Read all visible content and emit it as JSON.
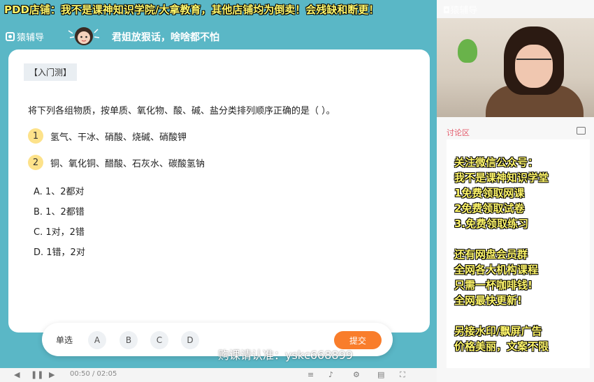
{
  "banner": "PDD店铺：我不是课神知识学院/大拿教育，其他店铺均为倒卖！会残缺和断更！",
  "watermark_top": "◘猿辅导",
  "header": {
    "logo": "猿辅导",
    "slogan": "君姐放狠话，啥啥都不怕"
  },
  "question": {
    "tag": "【入门测】",
    "text": "将下列各组物质，按单质、氧化物、酸、碱、盐分类排列顺序正确的是（   ）。",
    "statements": [
      {
        "num": "1",
        "text": "氢气、干冰、硝酸、烧碱、硝酸钾"
      },
      {
        "num": "2",
        "text": "铜、氧化铜、醋酸、石灰水、碳酸氢钠"
      }
    ],
    "options": [
      "A. 1、2都对",
      "B. 1、2都错",
      "C. 1对，2错",
      "D. 1错，2对"
    ]
  },
  "answer_bar": {
    "label": "单选",
    "choices": [
      "A",
      "B",
      "C",
      "D"
    ],
    "submit": "提交"
  },
  "watermark_bottom": "购课请认准：yskc668899",
  "controls": {
    "time": "00:50 / 02:05"
  },
  "discussion": {
    "title": "讨论区"
  },
  "promo": [
    "关注微信公众号：",
    "我不是课神知识学堂",
    "1免费领取网课",
    "2免费领取试卷",
    "3.免费领取练习",
    "",
    "还有网盘会员群",
    "全网各大机构课程",
    "只需一杯咖啡钱!",
    "全网最快更新!",
    "",
    "另接水印/飘屏广告",
    "价格美丽，文案不限"
  ]
}
